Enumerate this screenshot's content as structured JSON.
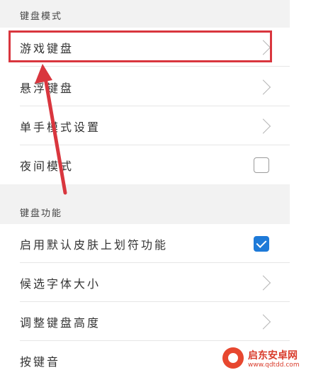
{
  "sections": [
    {
      "title": "键盘模式",
      "rows": [
        {
          "label": "游戏键盘",
          "control": "chevron"
        },
        {
          "label": "悬浮键盘",
          "control": "chevron"
        },
        {
          "label": "单手模式设置",
          "control": "chevron"
        },
        {
          "label": "夜间模式",
          "control": "checkbox",
          "checked": false
        }
      ]
    },
    {
      "title": "键盘功能",
      "rows": [
        {
          "label": "启用默认皮肤上划符功能",
          "control": "checkbox",
          "checked": true
        },
        {
          "label": "候选字体大小",
          "control": "chevron"
        },
        {
          "label": "调整键盘高度",
          "control": "chevron"
        },
        {
          "label": "按键音",
          "control": "none"
        }
      ]
    }
  ],
  "annotation": {
    "highlight_color": "#d9363e",
    "highlighted_row": "游戏键盘"
  },
  "watermark": {
    "title": "启东安卓网",
    "url": "www.qdtdd.com"
  }
}
